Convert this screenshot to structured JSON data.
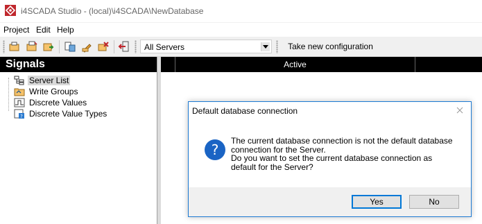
{
  "window": {
    "title": "i4SCADA Studio - (local)\\i4SCADA\\NewDatabase"
  },
  "menu": {
    "items": [
      "Project",
      "Edit",
      "Help"
    ]
  },
  "toolbar": {
    "server_filter": "All Servers",
    "take_config_label": "Take new configuration"
  },
  "signals": {
    "header": "Signals",
    "items": [
      "Server List",
      "Write Groups",
      "Discrete Values",
      "Discrete Value Types"
    ]
  },
  "grid": {
    "columns": [
      "",
      "Active"
    ]
  },
  "dialog": {
    "title": "Default database connection",
    "message_lines": [
      "The current database connection is not the default database",
      "connection for the Server.",
      "Do you want to set the current database connection as",
      "default for the Server?"
    ],
    "yes_label": "Yes",
    "no_label": "No"
  },
  "colors": {
    "accent": "#0078d7",
    "header_bg": "#000000",
    "icon_red": "#c0272d"
  }
}
